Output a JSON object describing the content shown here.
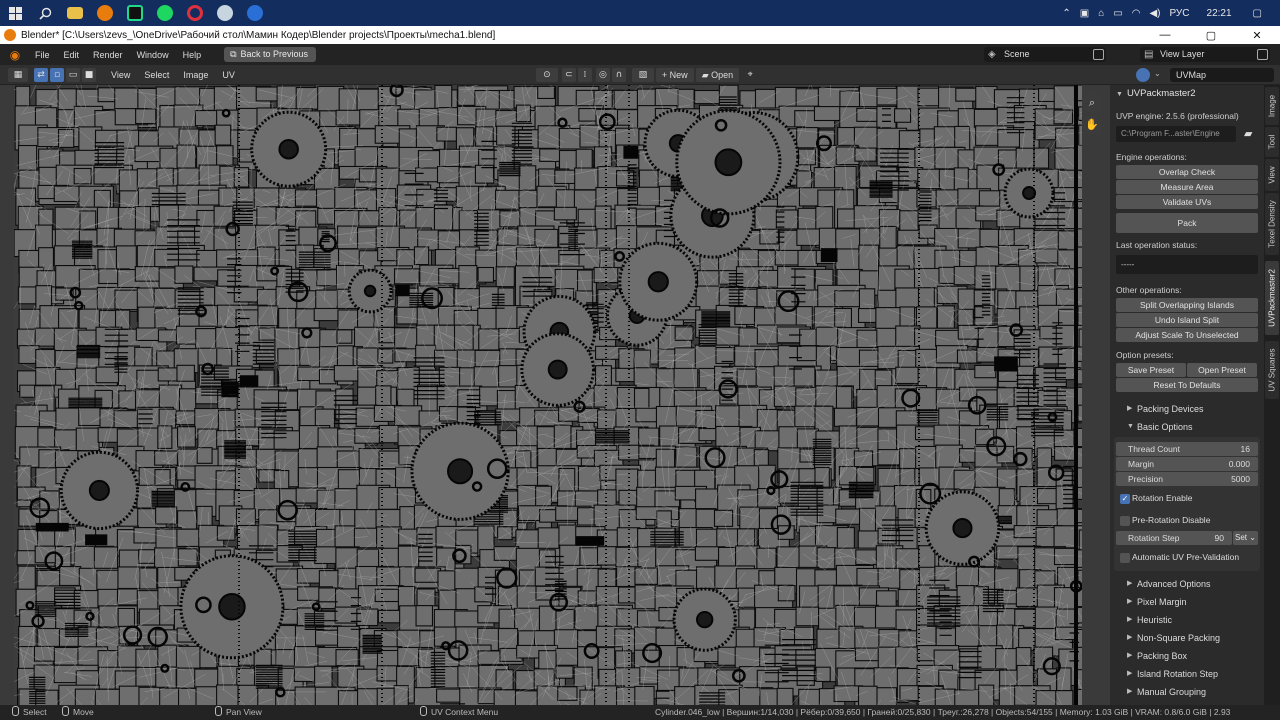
{
  "taskbar": {
    "icons": [
      "windows-icon",
      "search-icon",
      "file-explorer-icon",
      "blender-app-icon",
      "pycharm-icon",
      "spotify-icon",
      "opera-icon",
      "steam-icon",
      "app-icon"
    ],
    "language": "РУС",
    "time": "22:21"
  },
  "window": {
    "title": "Blender* [C:\\Users\\zevs_\\OneDrive\\Рабочий стол\\Мамин Кодер\\Blender projects\\Проекты\\mecha1.blend]"
  },
  "menubar": {
    "items": [
      "File",
      "Edit",
      "Render",
      "Window",
      "Help"
    ],
    "back_button": "Back to Previous",
    "scene_label": "Scene",
    "view_layer_label": "View Layer"
  },
  "uv_header": {
    "menus": [
      "View",
      "Select",
      "Image",
      "UV"
    ],
    "new_label": "New",
    "open_label": "Open",
    "uvmap_label": "UVMap"
  },
  "sidepanel": {
    "title": "UVPackmaster2",
    "engine_label": "UVP engine: 2.5.6 (professional)",
    "engine_path": "C:\\Program F...aster\\Engine",
    "engine_ops_label": "Engine operations:",
    "overlap_check": "Overlap Check",
    "measure_area": "Measure Area",
    "validate_uvs": "Validate UVs",
    "pack": "Pack",
    "last_status_label": "Last operation status:",
    "last_status_value": "-----",
    "other_ops_label": "Other operations:",
    "split_overlapping": "Split Overlapping Islands",
    "undo_split": "Undo Island Split",
    "adjust_scale": "Adjust Scale To Unselected",
    "option_presets_label": "Option presets:",
    "save_preset": "Save Preset",
    "open_preset": "Open Preset",
    "reset_defaults": "Reset To Defaults",
    "packing_devices": "Packing Devices",
    "basic_options": "Basic Options",
    "thread_count_label": "Thread Count",
    "thread_count_value": "16",
    "margin_label": "Margin",
    "margin_value": "0.000",
    "precision_label": "Precision",
    "precision_value": "5000",
    "rotation_enable": "Rotation Enable",
    "rotation_enable_checked": true,
    "pre_rotation_disable": "Pre-Rotation Disable",
    "pre_rotation_disable_checked": false,
    "rotation_step_label": "Rotation Step",
    "rotation_step_value": "90",
    "set_label": "Set",
    "auto_prevalidation": "Automatic UV Pre-Validation",
    "auto_prevalidation_checked": false,
    "collapsed_sections": [
      "Advanced Options",
      "Pixel Margin",
      "Heuristic",
      "Non-Square Packing",
      "Packing Box",
      "Island Rotation Step",
      "Manual Grouping"
    ]
  },
  "vtabs": [
    "Image",
    "Tool",
    "View",
    "Texel Density",
    "UVPackmaster2",
    "UV Squares"
  ],
  "statusbar": {
    "select": "Select",
    "move": "Move",
    "pan_view": "Pan View",
    "context_menu": "UV Context Menu",
    "stats": "Cylinder.046_low | Вершин:1/14,030 | Рёбер:0/39,650 | Граней:0/25,830 | Треуг.:26,278 | Objects:54/155 | Memory: 1.03 GiB | VRAM: 0.8/6.0 GiB | 2.93"
  },
  "colors": {
    "taskbar": "#142d5f",
    "accent": "#4772b3",
    "uv_background": "#3a3a3a",
    "uv_islands": "#6e6e6e",
    "panel_bg": "#2b2b2b",
    "button": "#545454"
  }
}
